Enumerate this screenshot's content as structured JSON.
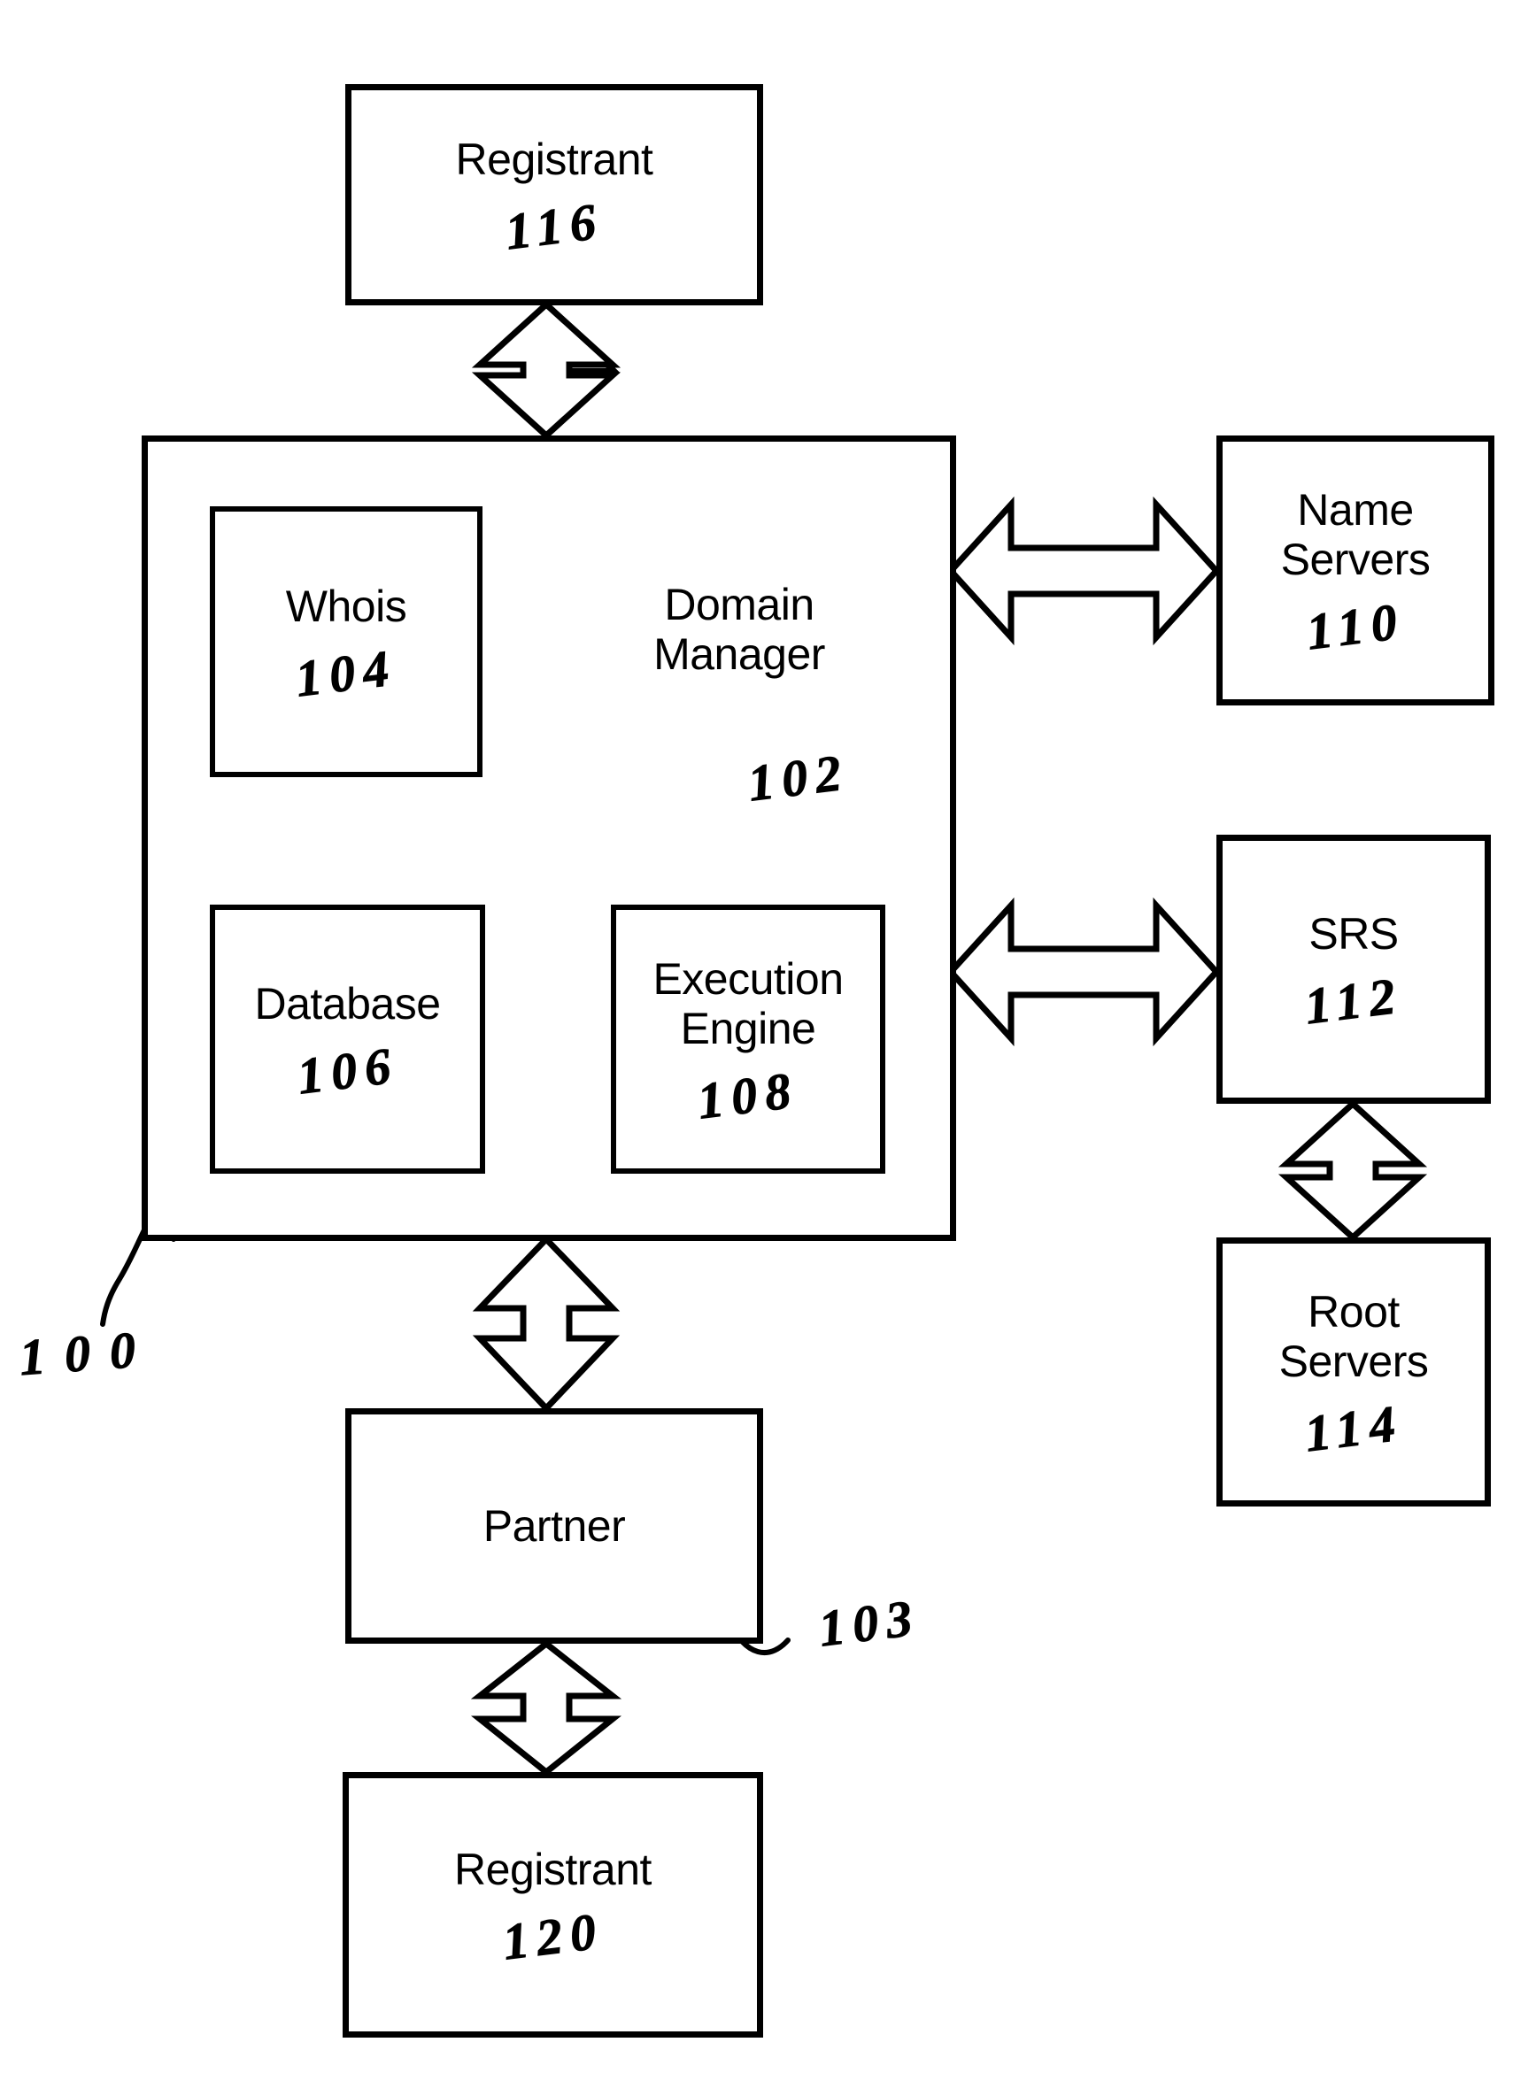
{
  "figure": {
    "type": "patent-block-diagram",
    "system_ref": "100",
    "background": "#ffffff",
    "stroke": "#000000"
  },
  "nodes": {
    "registrant_top": {
      "label": "Registrant",
      "ref": "116"
    },
    "domain_manager": {
      "label": "Domain\nManager",
      "ref": "102"
    },
    "whois": {
      "label": "Whois",
      "ref": "104"
    },
    "database": {
      "label": "Database",
      "ref": "106"
    },
    "execution_engine": {
      "label": "Execution\nEngine",
      "ref": "108"
    },
    "name_servers": {
      "label": "Name\nServers",
      "ref": "110"
    },
    "srs": {
      "label": "SRS",
      "ref": "112"
    },
    "root_servers": {
      "label": "Root\nServers",
      "ref": "114"
    },
    "partner": {
      "label": "Partner",
      "ref": "103"
    },
    "registrant_bottom": {
      "label": "Registrant",
      "ref": "120"
    }
  },
  "connectors": [
    {
      "name": "registrant-top-to-domain-manager",
      "kind": "double-arrow",
      "orientation": "vertical"
    },
    {
      "name": "domain-manager-to-name-servers",
      "kind": "double-arrow",
      "orientation": "horizontal"
    },
    {
      "name": "domain-manager-to-srs",
      "kind": "double-arrow",
      "orientation": "horizontal"
    },
    {
      "name": "srs-to-root-servers",
      "kind": "double-arrow",
      "orientation": "vertical"
    },
    {
      "name": "domain-manager-to-partner",
      "kind": "double-arrow",
      "orientation": "vertical"
    },
    {
      "name": "partner-to-registrant-bottom",
      "kind": "double-arrow",
      "orientation": "vertical"
    }
  ]
}
